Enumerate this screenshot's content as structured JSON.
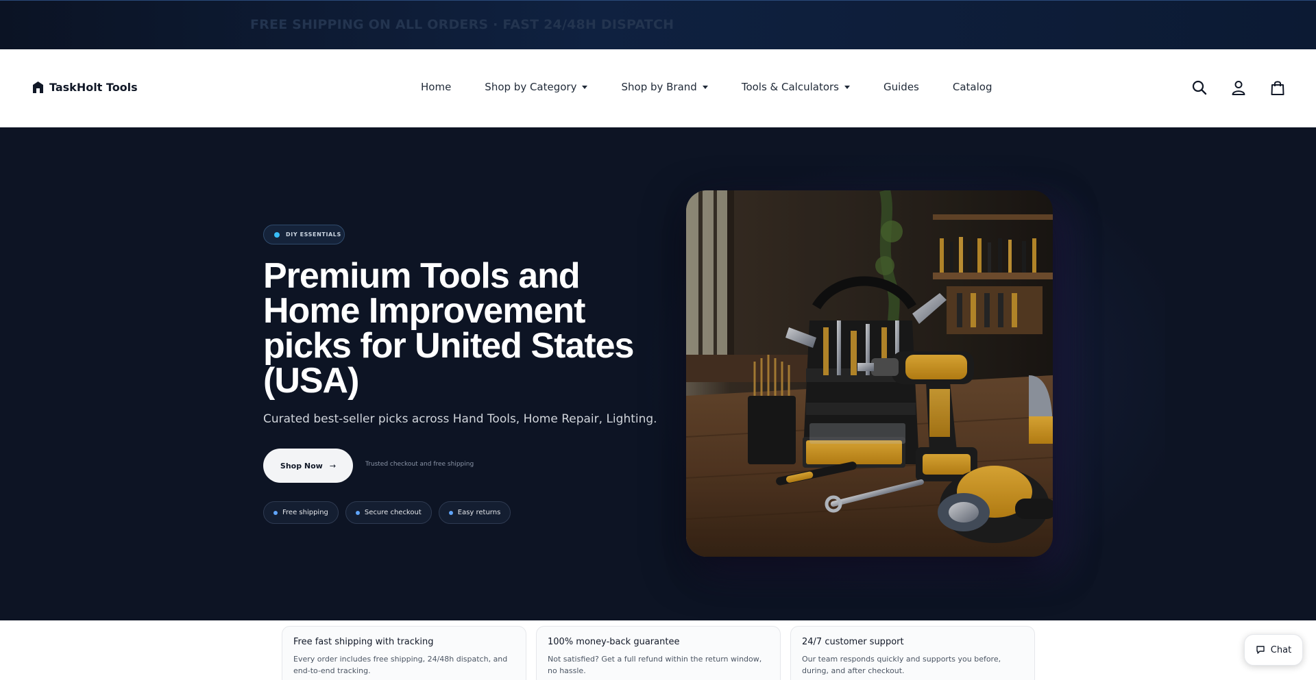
{
  "announcement": {
    "text": "FREE SHIPPING ON ALL ORDERS · FAST 24/48H DISPATCH"
  },
  "header": {
    "brand": "TaskHolt Tools",
    "nav": [
      {
        "label": "Home",
        "dropdown": false
      },
      {
        "label": "Shop by Category",
        "dropdown": true
      },
      {
        "label": "Shop by Brand",
        "dropdown": true
      },
      {
        "label": "Tools & Calculators",
        "dropdown": true
      },
      {
        "label": "Guides",
        "dropdown": false
      },
      {
        "label": "Catalog",
        "dropdown": false
      }
    ],
    "icons": [
      "search-icon",
      "account-icon",
      "cart-icon"
    ]
  },
  "hero": {
    "badge": "DIY ESSENTIALS",
    "title": "Premium Tools and Home Improvement picks for United States (USA)",
    "subtitle": "Curated best-seller picks across Hand Tools, Home Repair, Lighting.",
    "cta_label": "Shop Now",
    "cta_arrow": "→",
    "trusted_text": "Trusted checkout and free shipping",
    "pills": [
      "Free shipping",
      "Secure checkout",
      "Easy returns"
    ]
  },
  "features": [
    {
      "title": "Free fast shipping with tracking",
      "body": "Every order includes free shipping, 24/48h dispatch, and end-to-end tracking."
    },
    {
      "title": "100% money-back guarantee",
      "body": "Not satisfied? Get a full refund within the return window, no hassle."
    },
    {
      "title": "24/7 customer support",
      "body": "Our team responds quickly and supports you before, during, and after checkout."
    }
  ],
  "chat": {
    "label": "Chat"
  },
  "colors": {
    "hero_bg": "#0d1424",
    "accent": "#38bdf8",
    "tool_yellow": "#e0a526"
  }
}
